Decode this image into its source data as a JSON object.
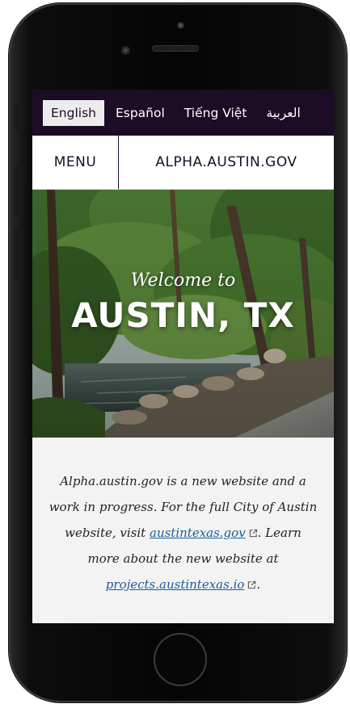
{
  "languages": [
    "English",
    "Español",
    "Tiếng Việt",
    "العربية"
  ],
  "header": {
    "menu_label": "MENU",
    "site_title": "ALPHA.AUSTIN.GOV"
  },
  "hero": {
    "welcome": "Welcome to",
    "city": "AUSTIN, TX"
  },
  "intro": {
    "text_1": "Alpha.austin.gov is a new website and a work in progress. For the full City of Austin website, visit",
    "link_1": "austintexas.gov",
    "text_2": ". Learn more about the new website at",
    "link_2": "projects.austintexas.io",
    "text_3": "."
  },
  "icons": {
    "external_link": "external-link-icon"
  },
  "colors": {
    "header_bg": "#1c0c26",
    "link": "#1d5b9a",
    "content_bg": "#f3f3f3"
  }
}
